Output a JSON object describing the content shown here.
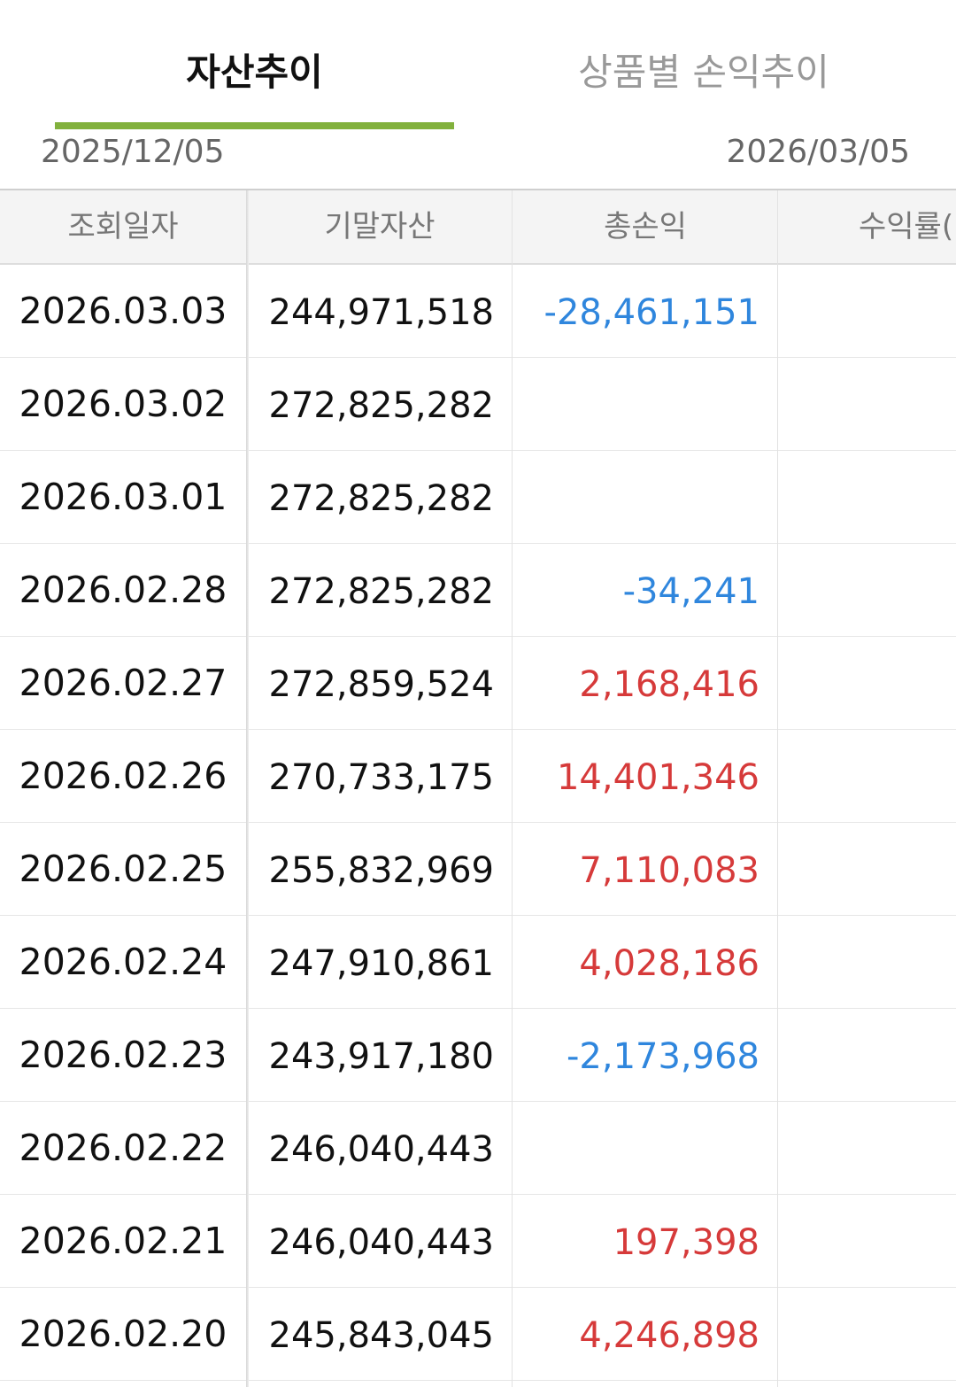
{
  "tabs": [
    {
      "label": "자산추이",
      "active": true
    },
    {
      "label": "상품별 손익추이",
      "active": false
    }
  ],
  "date_range": {
    "start": "2025/12/05",
    "end": "2026/03/05"
  },
  "table": {
    "headers": [
      "조회일자",
      "기말자산",
      "총손익",
      "수익률("
    ],
    "rows": [
      {
        "date": "2026.03.03",
        "asset": "244,971,518",
        "pnl": "-28,461,151",
        "sign": "neg"
      },
      {
        "date": "2026.03.02",
        "asset": "272,825,282",
        "pnl": "",
        "sign": ""
      },
      {
        "date": "2026.03.01",
        "asset": "272,825,282",
        "pnl": "",
        "sign": ""
      },
      {
        "date": "2026.02.28",
        "asset": "272,825,282",
        "pnl": "-34,241",
        "sign": "neg"
      },
      {
        "date": "2026.02.27",
        "asset": "272,859,524",
        "pnl": "2,168,416",
        "sign": "pos"
      },
      {
        "date": "2026.02.26",
        "asset": "270,733,175",
        "pnl": "14,401,346",
        "sign": "pos"
      },
      {
        "date": "2026.02.25",
        "asset": "255,832,969",
        "pnl": "7,110,083",
        "sign": "pos"
      },
      {
        "date": "2026.02.24",
        "asset": "247,910,861",
        "pnl": "4,028,186",
        "sign": "pos"
      },
      {
        "date": "2026.02.23",
        "asset": "243,917,180",
        "pnl": "-2,173,968",
        "sign": "neg"
      },
      {
        "date": "2026.02.22",
        "asset": "246,040,443",
        "pnl": "",
        "sign": ""
      },
      {
        "date": "2026.02.21",
        "asset": "246,040,443",
        "pnl": "197,398",
        "sign": "pos"
      },
      {
        "date": "2026.02.20",
        "asset": "245,843,045",
        "pnl": "4,246,898",
        "sign": "pos"
      }
    ]
  },
  "colors": {
    "accent": "#82b13d",
    "negative": "#2f86dd",
    "positive": "#d63a3a"
  }
}
